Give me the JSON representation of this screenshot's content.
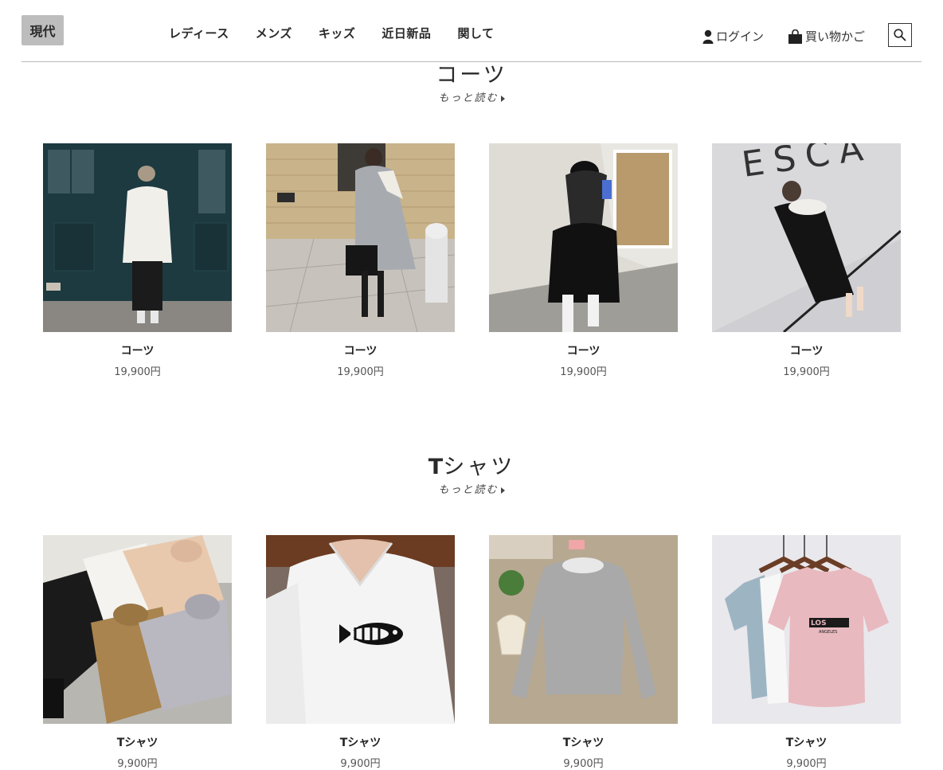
{
  "header": {
    "logo": "現代",
    "nav": [
      "レディース",
      "メンズ",
      "キッズ",
      "近日新品",
      "関して"
    ],
    "login_label": "ログイン",
    "cart_label": "買い物かご"
  },
  "sections": [
    {
      "title": "コーツ",
      "more_label": "もっと読む",
      "products": [
        {
          "name": "コーツ",
          "price": "19,900円"
        },
        {
          "name": "コーツ",
          "price": "19,900円"
        },
        {
          "name": "コーツ",
          "price": "19,900円"
        },
        {
          "name": "コーツ",
          "price": "19,900円"
        }
      ]
    },
    {
      "title_latin": "T",
      "title_rest": "シャツ",
      "more_label": "もっと読む",
      "products": [
        {
          "name": "Tシャツ",
          "price": "9,900円"
        },
        {
          "name": "Tシャツ",
          "price": "9,900円"
        },
        {
          "name": "Tシャツ",
          "price": "9,900円"
        },
        {
          "name": "Tシャツ",
          "price": "9,900円"
        }
      ]
    }
  ],
  "image_text": {
    "wall_letters": "ESCA",
    "shirt_print": "LOS",
    "shirt_print_sub": "ANGELES"
  },
  "colors": {
    "logo_bg": "#bdbdbd",
    "text": "#2a2a2a",
    "rule": "#b9b9b9"
  }
}
